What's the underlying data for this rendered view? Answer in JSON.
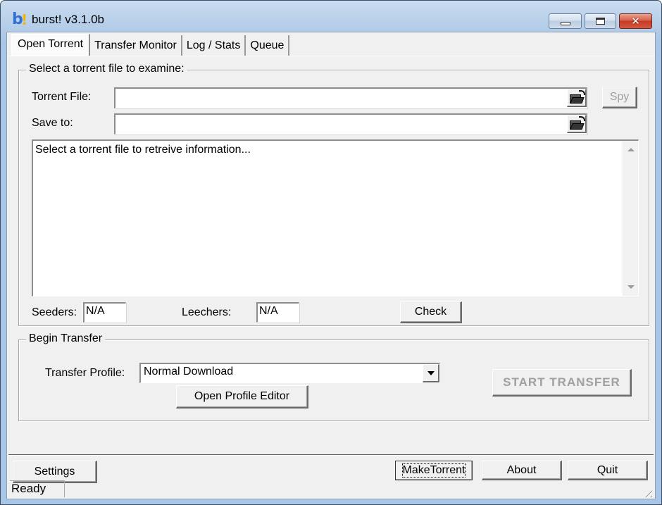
{
  "window": {
    "title": "burst! v3.1.0b",
    "icon": "burst-app-icon",
    "controls": {
      "minimize": "minimize-icon",
      "maximize": "maximize-icon",
      "close": "close-icon"
    }
  },
  "tabs": [
    {
      "label": "Open Torrent",
      "accel": "O",
      "active": true
    },
    {
      "label": "Transfer Monitor",
      "accel": "M",
      "active": false
    },
    {
      "label": "Log / Stats",
      "accel": "L",
      "active": false
    },
    {
      "label": "Queue",
      "accel": "u",
      "active": false
    }
  ],
  "select_group": {
    "legend": "Select a torrent file to examine:",
    "torrent_file_label": "Torrent File:",
    "torrent_file_value": "",
    "save_to_label": "Save to:",
    "save_to_value": "",
    "browse_icon": "folder-open-icon",
    "spy_label": "Spy",
    "info_text": "Select a torrent file to retreive information...",
    "seeders_label": "Seeders:",
    "seeders_value": "N/A",
    "leechers_label": "Leechers:",
    "leechers_value": "N/A",
    "check_label": "Check"
  },
  "transfer_group": {
    "legend": "Begin Transfer",
    "profile_label": "Transfer Profile:",
    "profile_value": "Normal Download",
    "open_profile_editor_label": "Open Profile Editor",
    "start_transfer_label": "START TRANSFER"
  },
  "bottom_buttons": {
    "settings": "Settings",
    "make_torrent": "MakeTorrent",
    "about": "About",
    "quit": "Quit"
  },
  "status": {
    "text": "Ready"
  }
}
